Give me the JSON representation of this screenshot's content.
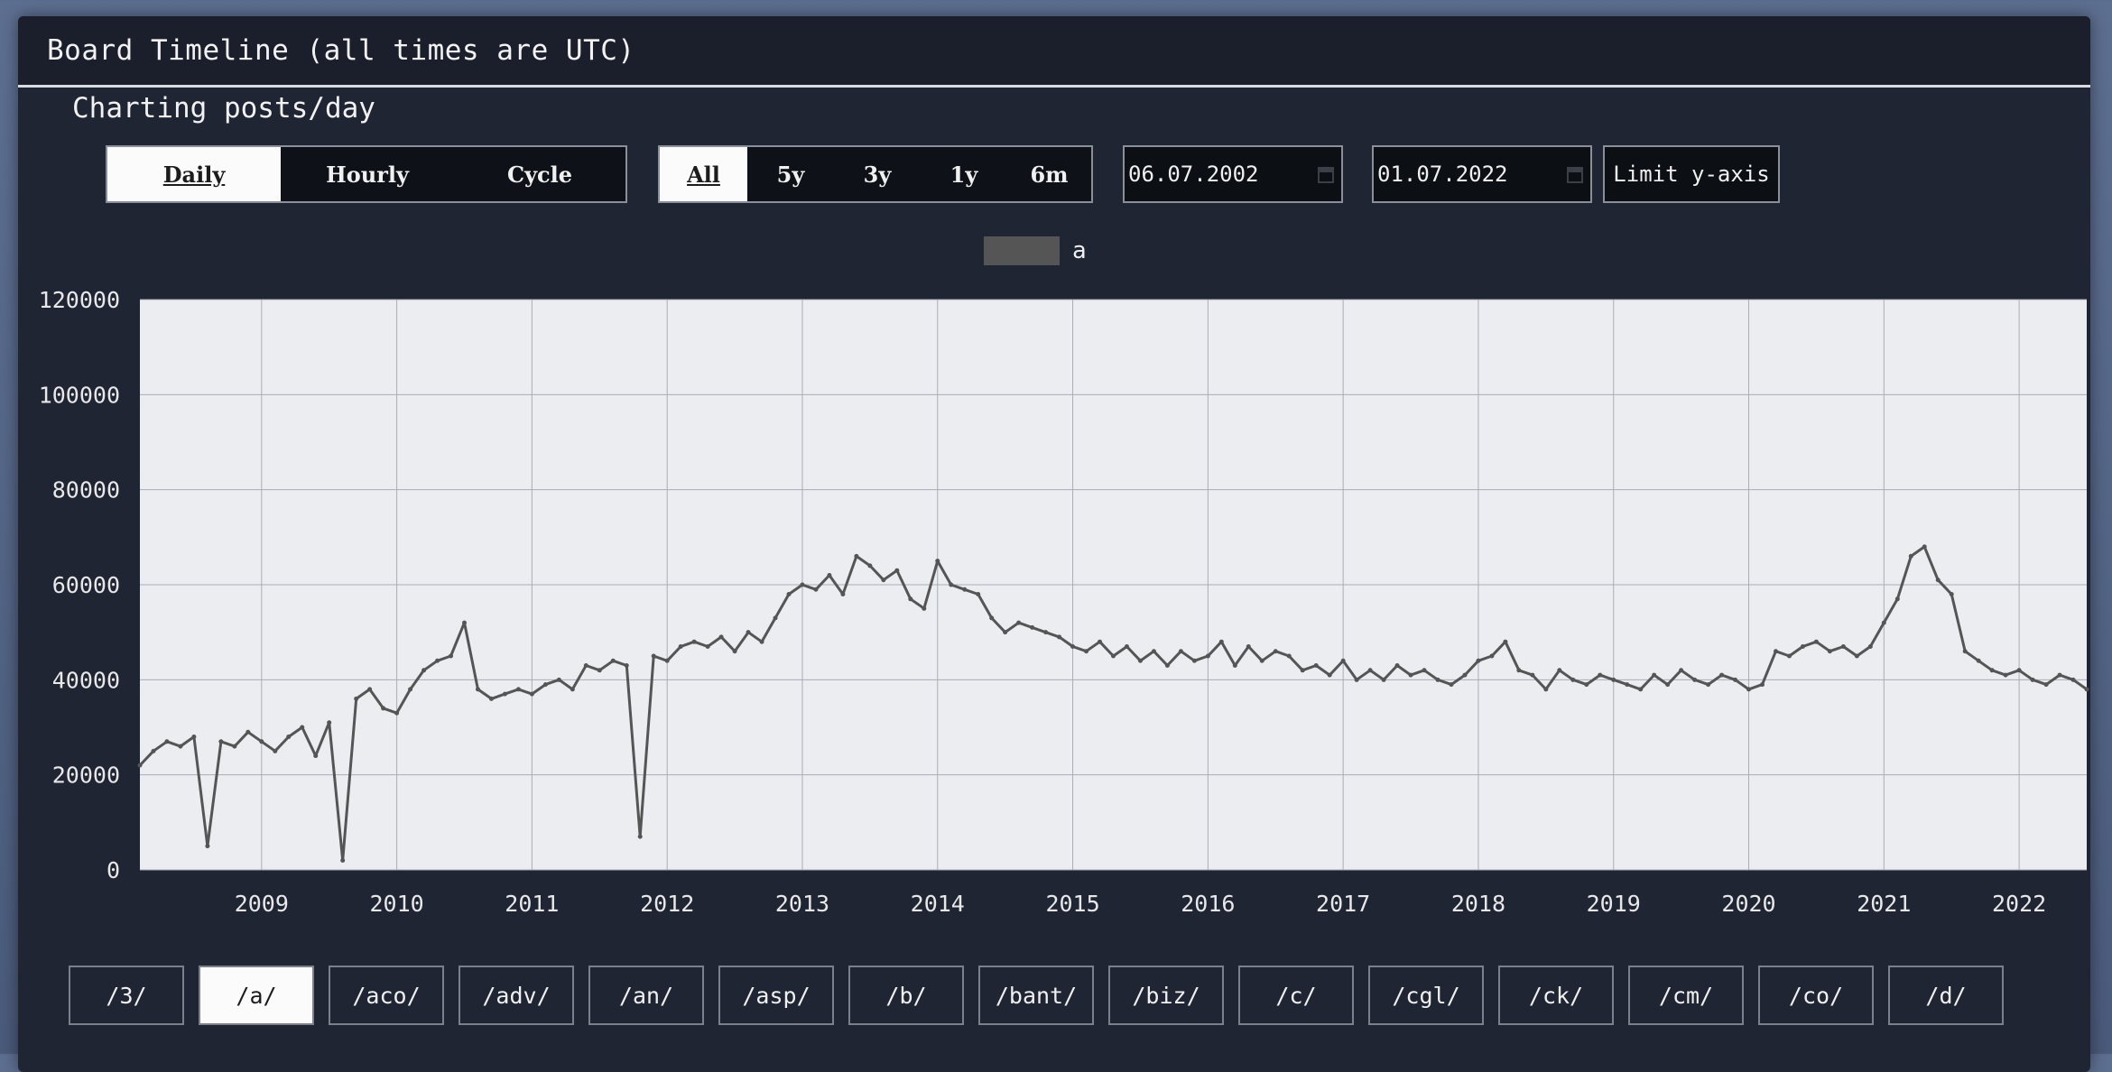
{
  "header": {
    "title": "Board Timeline (all times are UTC)"
  },
  "subtitle": "Charting posts/day",
  "mode_tabs": [
    {
      "label": "Daily",
      "active": true
    },
    {
      "label": "Hourly",
      "active": false
    },
    {
      "label": "Cycle",
      "active": false
    }
  ],
  "range_tabs": [
    {
      "label": "All",
      "active": true
    },
    {
      "label": "5y",
      "active": false
    },
    {
      "label": "3y",
      "active": false
    },
    {
      "label": "1y",
      "active": false
    },
    {
      "label": "6m",
      "active": false
    }
  ],
  "date_from": "06.07.2002",
  "date_to": "01.07.2022",
  "limit_button": "Limit y-axis",
  "boards": [
    {
      "label": "/3/",
      "active": false
    },
    {
      "label": "/a/",
      "active": true
    },
    {
      "label": "/aco/",
      "active": false
    },
    {
      "label": "/adv/",
      "active": false
    },
    {
      "label": "/an/",
      "active": false
    },
    {
      "label": "/asp/",
      "active": false
    },
    {
      "label": "/b/",
      "active": false
    },
    {
      "label": "/bant/",
      "active": false
    },
    {
      "label": "/biz/",
      "active": false
    },
    {
      "label": "/c/",
      "active": false
    },
    {
      "label": "/cgl/",
      "active": false
    },
    {
      "label": "/ck/",
      "active": false
    },
    {
      "label": "/cm/",
      "active": false
    },
    {
      "label": "/co/",
      "active": false
    },
    {
      "label": "/d/",
      "active": false
    }
  ],
  "colors": {
    "series": "#555555",
    "plot_bg": "#ebedf1",
    "grid": "#a9adb5"
  },
  "chart_data": {
    "type": "line",
    "title": "",
    "xlabel": "",
    "ylabel": "",
    "xlim": [
      2008.1,
      2022.5
    ],
    "ylim": [
      0,
      120000
    ],
    "y_ticks": [
      0,
      20000,
      40000,
      60000,
      80000,
      100000,
      120000
    ],
    "x_ticks": [
      "2009",
      "2010",
      "2011",
      "2012",
      "2013",
      "2014",
      "2015",
      "2016",
      "2017",
      "2018",
      "2019",
      "2020",
      "2021",
      "2022"
    ],
    "grid": true,
    "legend_position": "top-center",
    "series": [
      {
        "name": "a",
        "x": [
          2008.1,
          2008.2,
          2008.3,
          2008.4,
          2008.5,
          2008.6,
          2008.7,
          2008.8,
          2008.9,
          2009.0,
          2009.1,
          2009.2,
          2009.3,
          2009.4,
          2009.5,
          2009.6,
          2009.7,
          2009.8,
          2009.9,
          2010.0,
          2010.1,
          2010.2,
          2010.3,
          2010.4,
          2010.5,
          2010.6,
          2010.7,
          2010.8,
          2010.9,
          2011.0,
          2011.1,
          2011.2,
          2011.3,
          2011.4,
          2011.5,
          2011.6,
          2011.7,
          2011.8,
          2011.9,
          2012.0,
          2012.1,
          2012.2,
          2012.3,
          2012.4,
          2012.5,
          2012.6,
          2012.7,
          2012.8,
          2012.9,
          2013.0,
          2013.1,
          2013.2,
          2013.3,
          2013.4,
          2013.5,
          2013.6,
          2013.7,
          2013.8,
          2013.9,
          2014.0,
          2014.1,
          2014.2,
          2014.3,
          2014.4,
          2014.5,
          2014.6,
          2014.7,
          2014.8,
          2014.9,
          2015.0,
          2015.1,
          2015.2,
          2015.3,
          2015.4,
          2015.5,
          2015.6,
          2015.7,
          2015.8,
          2015.9,
          2016.0,
          2016.1,
          2016.2,
          2016.3,
          2016.4,
          2016.5,
          2016.6,
          2016.7,
          2016.8,
          2016.9,
          2017.0,
          2017.1,
          2017.2,
          2017.3,
          2017.4,
          2017.5,
          2017.6,
          2017.7,
          2017.8,
          2017.9,
          2018.0,
          2018.1,
          2018.2,
          2018.3,
          2018.4,
          2018.5,
          2018.6,
          2018.7,
          2018.8,
          2018.9,
          2019.0,
          2019.1,
          2019.2,
          2019.3,
          2019.4,
          2019.5,
          2019.6,
          2019.7,
          2019.8,
          2019.9,
          2020.0,
          2020.1,
          2020.2,
          2020.3,
          2020.4,
          2020.5,
          2020.6,
          2020.7,
          2020.8,
          2020.9,
          2021.0,
          2021.1,
          2021.2,
          2021.3,
          2021.4,
          2021.5,
          2021.6,
          2021.7,
          2021.8,
          2021.9,
          2022.0,
          2022.1,
          2022.2,
          2022.3,
          2022.4,
          2022.5
        ],
        "y": [
          22000,
          25000,
          27000,
          26000,
          28000,
          5000,
          27000,
          26000,
          29000,
          27000,
          25000,
          28000,
          30000,
          24000,
          31000,
          2000,
          36000,
          38000,
          34000,
          33000,
          38000,
          42000,
          44000,
          45000,
          52000,
          38000,
          36000,
          37000,
          38000,
          37000,
          39000,
          40000,
          38000,
          43000,
          42000,
          44000,
          43000,
          7000,
          45000,
          44000,
          47000,
          48000,
          47000,
          49000,
          46000,
          50000,
          48000,
          53000,
          58000,
          60000,
          59000,
          62000,
          58000,
          66000,
          64000,
          61000,
          63000,
          57000,
          55000,
          65000,
          60000,
          59000,
          58000,
          53000,
          50000,
          52000,
          51000,
          50000,
          49000,
          47000,
          46000,
          48000,
          45000,
          47000,
          44000,
          46000,
          43000,
          46000,
          44000,
          45000,
          48000,
          43000,
          47000,
          44000,
          46000,
          45000,
          42000,
          43000,
          41000,
          44000,
          40000,
          42000,
          40000,
          43000,
          41000,
          42000,
          40000,
          39000,
          41000,
          44000,
          45000,
          48000,
          42000,
          41000,
          38000,
          42000,
          40000,
          39000,
          41000,
          40000,
          39000,
          38000,
          41000,
          39000,
          42000,
          40000,
          39000,
          41000,
          40000,
          38000,
          39000,
          46000,
          45000,
          47000,
          48000,
          46000,
          47000,
          45000,
          47000,
          52000,
          57000,
          66000,
          68000,
          61000,
          58000,
          46000,
          44000,
          42000,
          41000,
          42000,
          40000,
          39000,
          41000,
          40000,
          38000
        ]
      }
    ]
  }
}
